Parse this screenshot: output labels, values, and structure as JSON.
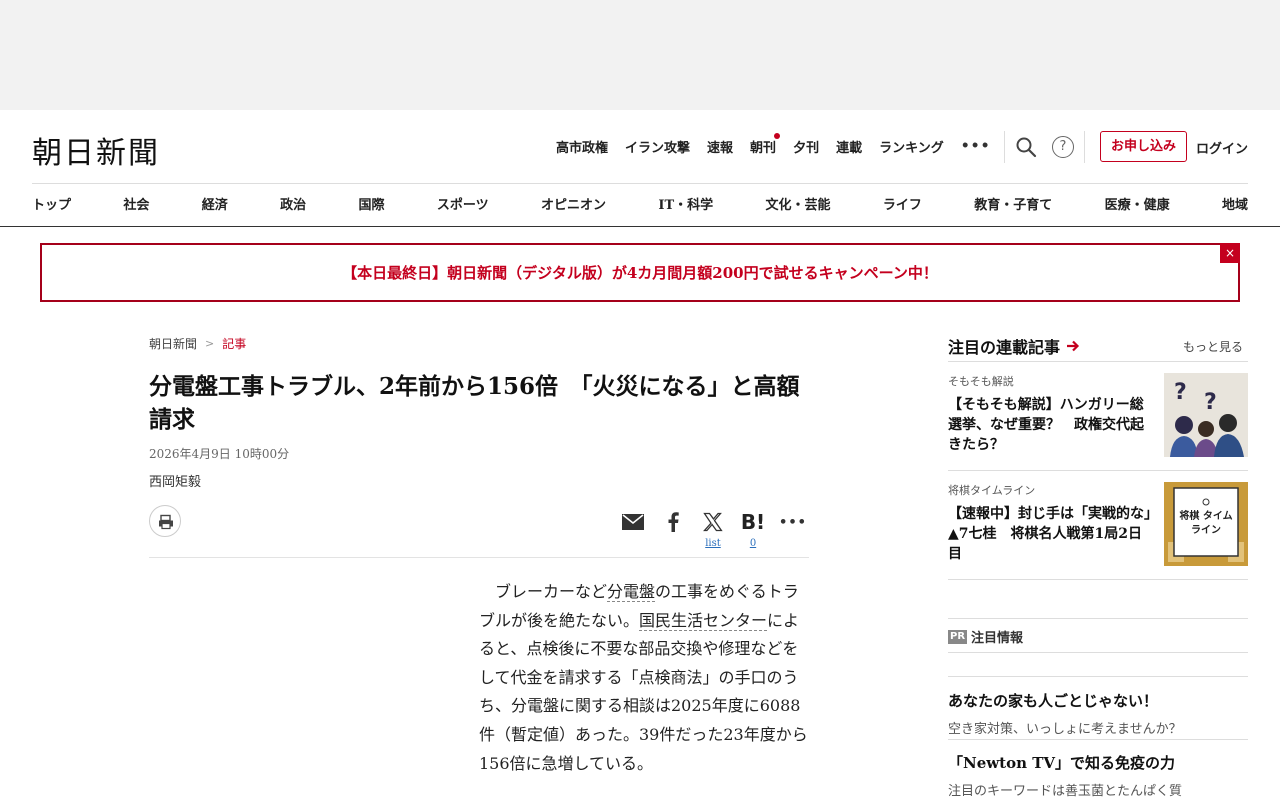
{
  "header": {
    "logo": "朝日新聞",
    "utility_links": [
      {
        "label": "高市政権",
        "dot": false
      },
      {
        "label": "イラン攻撃",
        "dot": false
      },
      {
        "label": "速報",
        "dot": false
      },
      {
        "label": "朝刊",
        "dot": true
      },
      {
        "label": "夕刊",
        "dot": false
      },
      {
        "label": "連載",
        "dot": false
      },
      {
        "label": "ランキング",
        "dot": false
      }
    ],
    "more_label": "•••",
    "help_label": "?",
    "subscribe_label": "お申し込み",
    "login_label": "ログイン"
  },
  "categories": [
    "トップ",
    "社会",
    "経済",
    "政治",
    "国際",
    "スポーツ",
    "オピニオン",
    "IT・科学",
    "文化・芸能",
    "ライフ",
    "教育・子育て",
    "医療・健康",
    "地域"
  ],
  "campaign": {
    "text": "【本日最終日】朝日新聞（デジタル版）が4カ月間月額200円で試せるキャンペーン中！",
    "close_label": "×"
  },
  "breadcrumb": {
    "home": "朝日新聞",
    "separator": ">",
    "current": "記事"
  },
  "article": {
    "title": "分電盤工事トラブル、2年前から156倍　「火災になる」と高額請求",
    "date": "2026年4月9日 10時00分",
    "author": "西岡矩毅",
    "share": {
      "x_count_label": "list",
      "hatena_label": "B!",
      "hatena_count": "0",
      "more_label": "•••"
    },
    "body": {
      "p1": "ブレーカーなど",
      "k1": "分電盤",
      "p2": "の工事をめぐるトラブルが後を絶たない。",
      "k2": "国民生活センター",
      "p3": "によると、点検後に不要な部品交換や修理などをして代金を請求する「点検商法」の手口のうち、分電盤に関する相談は2025年度に6088件（暫定値）あった。39件だった23年度から156倍に急増している。"
    }
  },
  "sidebar": {
    "title": "注目の連載記事",
    "more_label": "もっと見る",
    "items": [
      {
        "kicker": "そもそも解説",
        "headline": "【そもそも解説】ハンガリー総選挙、なぜ重要？　政権交代起きたら？"
      },
      {
        "kicker": "将棋タイムライン",
        "headline": "【速報中】封じ手は「実戦的な」▲7七桂　将棋名人戦第1局2日目",
        "thumb_title": "将棋 タイムライン"
      }
    ],
    "pr": {
      "badge": "PR",
      "title": "注目情報",
      "items": [
        {
          "headline": "あなたの家も人ごとじゃない！",
          "sub": "空き家対策、いっしょに考えませんか？"
        },
        {
          "headline": "「Newton TV」で知る免疫の力",
          "sub": "注目のキーワードは善玉菌とたんぱく質"
        }
      ]
    }
  },
  "colors": {
    "brand_red": "#c4001e",
    "link_blue": "#2a6ebb"
  }
}
